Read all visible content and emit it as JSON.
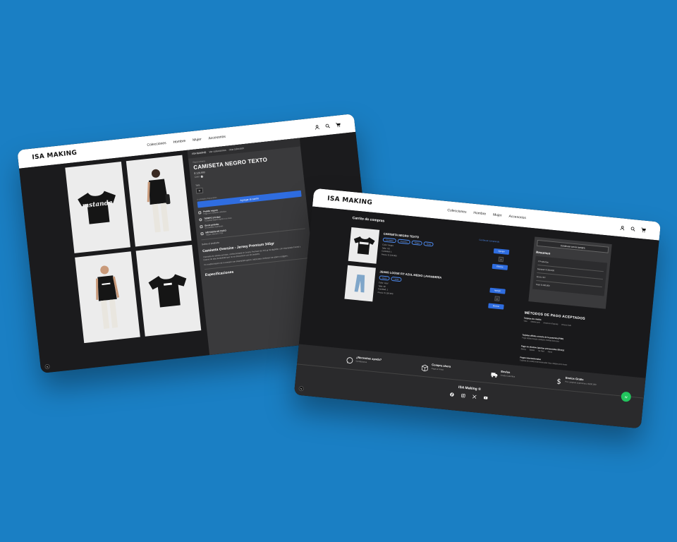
{
  "brand": "ISA MAKING",
  "nav": [
    "Colecciones",
    "Hombre",
    "Mujer",
    "Accesorios"
  ],
  "product_page": {
    "breadcrumb": [
      "ISA MAKING",
      "Ver colecciones",
      "otra colección"
    ],
    "tag": "Ropa urbana",
    "title": "CAMISETA NEGRO TEXTO",
    "price": "$ 129.900",
    "color_label": "Color",
    "size_label": "Talla",
    "size_value": "M",
    "stock": "4 unidades disponibles",
    "add_to_cart": "Agregar al carrito",
    "print_text": "mstanda",
    "features": [
      {
        "title": "Pedido seguro",
        "sub": "Paga con múltiples métodos"
      },
      {
        "title": "TIEMPO 2-5 días",
        "sub": "Tu pedido llegará rápido a tu casa"
      },
      {
        "title": "Envío gratuito",
        "sub": "En pedidos superiores"
      },
      {
        "title": "MÉTODOS DE PAGO",
        "sub": "Tarjeta, efectivo, PSE"
      }
    ],
    "about": "Sobre el producto",
    "desc_title": "Camiseta Oversize - Jersey Premium 345gr",
    "desc_1": "Camiseta de silueta oversize, confeccionada en Jersey Premium de 345 gr de algodón, con estampado frontal y trasero de alta durabilidad que no se desvanece con los lavados.",
    "desc_2": "Un modelo básico de tu armario con estampado gótico. Ideal para combinar con jeans o joggers.",
    "spec_title": "Especificaciones"
  },
  "cart_page": {
    "title": "Carrito de compras",
    "keep_shopping": "Continuar comprando",
    "items": [
      {
        "name": "CAMISETA NEGRO TEXTO",
        "chips": [
          "Camiseta",
          "Oversize",
          "Negro",
          "Texto"
        ],
        "meta": [
          "Color: Negro",
          "Talla: XS",
          "Cantidad: 1",
          "Precio: $ 129.900"
        ],
        "qty": "1",
        "add_label": "Agregar",
        "remove_label": "Eliminar"
      },
      {
        "name": "JEANS LOOSE FIT AZUL MEDIO LAVANDERÍA",
        "chips": [
          "Jeans",
          "Loose"
        ],
        "meta": [
          "Color: Azul",
          "Talla: 30",
          "Cantidad: 1",
          "Precio: $ 159.900"
        ],
        "qty": "1",
        "add_label": "Agregar",
        "remove_label": "Eliminar"
      }
    ],
    "checkout": "Continuar con la compra",
    "summary_title": "Resumen",
    "summary_rows": [
      "2 Productos",
      "Subtotal: $ 289.800",
      "Envío: $ 0",
      "Total: $ 289.800"
    ],
    "payment_title": "MÉTODOS DE PAGO ACEPTADOS",
    "payment_groups": [
      {
        "title": "Tarjetas de crédito",
        "items": [
          "Visa",
          "Mastercard",
          "American Express",
          "Diners Club"
        ]
      },
      {
        "title": "Tarjetas débito a través de la pasarela (PSE)",
        "items": [
          "Pago débito desde cualquier entidad bancaria"
        ]
      },
      {
        "title": "Pago en efectivo (puntos presenciales Efecty)",
        "items": [
          "Efecty",
          "Baloto",
          "Su Red",
          "Gana"
        ]
      },
      {
        "title": "Pagos internacionales",
        "items": [
          "Tarjetas de crédito internacionales Visa, Mastercard, Amex"
        ]
      }
    ],
    "footer_cols": [
      {
        "icon": "whatsapp-icon",
        "title": "¿Necesitas ayuda?",
        "sub": "Contáctanos"
      },
      {
        "icon": "box-icon",
        "title": "Compra ahora",
        "sub": "Paga en línea"
      },
      {
        "icon": "truck-icon",
        "title": "Envíos",
        "sub": "A toda Colombia"
      },
      {
        "icon": "dollar-icon",
        "title": "Envíos Gratis",
        "sub": "Por compras superiores a $200.000"
      }
    ],
    "footer_brand": "ISA Making ®",
    "whatsapp_label": "W"
  },
  "corner_badge": "N",
  "colors": {
    "background": "#1a7fc4",
    "accent": "#2f6de0",
    "dark": "#1c1c1e",
    "whatsapp": "#22c55e"
  }
}
